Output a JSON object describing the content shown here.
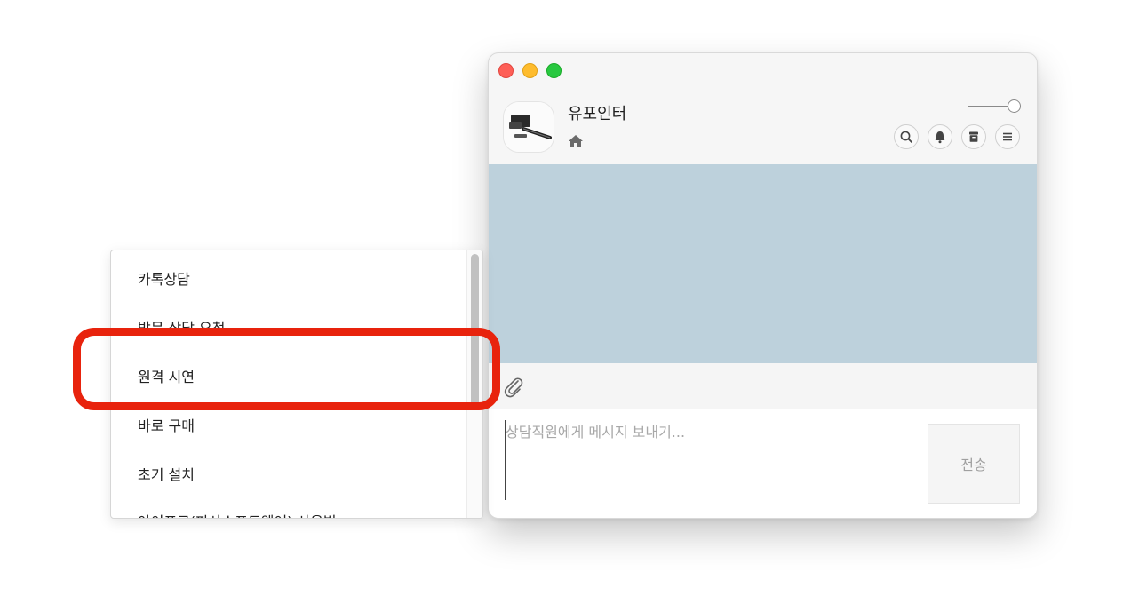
{
  "window": {
    "channel_name": "유포인터",
    "icons": [
      "home-icon",
      "search-icon",
      "bell-icon",
      "archive-icon",
      "menu-icon",
      "paperclip-icon"
    ],
    "message_placeholder": "상담직원에게 메시지 보내기...",
    "send_label": "전송",
    "chat_background": "#bdd1dc"
  },
  "menu": {
    "items": [
      "카톡상담",
      "방문 상담 요청",
      "원격 시연",
      "바로 구매",
      "초기 설치",
      "아이프로(파사스포트웨어) 사용법"
    ],
    "highlighted_item": "원격 시연"
  },
  "highlight_color": "#e8230d"
}
